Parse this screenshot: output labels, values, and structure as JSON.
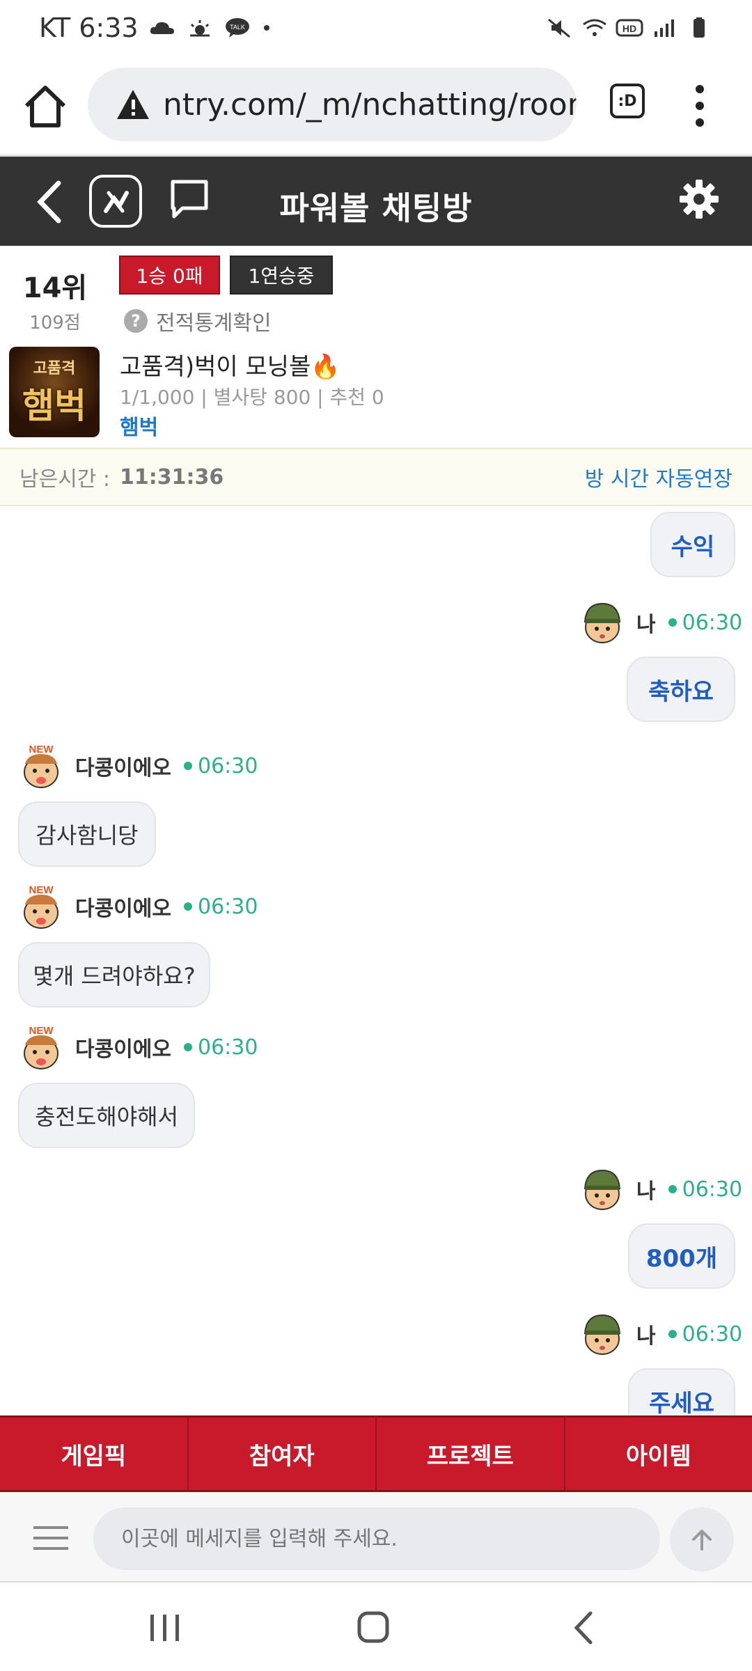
{
  "status_bar": {
    "carrier_time": "KT 6:33",
    "icons": [
      "cloud-icon",
      "sunrise-icon",
      "talk-icon",
      "dot-icon",
      "mute-icon",
      "wifi-icon",
      "hd-icon",
      "signal-icon",
      "battery-icon"
    ],
    "talk_badge": "TALK",
    "hd_badge": "HD"
  },
  "browser": {
    "url": "ntry.com/_m/nchatting/room",
    "tab_switcher_label": ":D"
  },
  "header": {
    "title": "파워볼 채팅방"
  },
  "room": {
    "rank": "14위",
    "points": "109점",
    "record_badge": "1승 0패",
    "streak_badge": "1연승중",
    "stats_link": "전적통계확인",
    "thumb_top": "고품격",
    "thumb_main": "햄벅",
    "name": "고품격)벅이 모닝볼🔥",
    "meta": "1/1,000 | 별사탕 800 | 추천 0",
    "owner": "햄벅"
  },
  "timer": {
    "label": "남은시간 :",
    "value": "11:31:36",
    "extend_link": "방 시간 자동연장"
  },
  "messages": [
    {
      "sender": "",
      "time": "",
      "text": "수익",
      "mine": true
    },
    {
      "sender": "나",
      "time": "06:30",
      "text": "축하요",
      "mine": true
    },
    {
      "sender": "다콩이에오",
      "time": "06:30",
      "text": "감사함니당",
      "mine": false
    },
    {
      "sender": "다콩이에오",
      "time": "06:30",
      "text": "몇개 드려야하요?",
      "mine": false
    },
    {
      "sender": "다콩이에오",
      "time": "06:30",
      "text": "충전도해야해서",
      "mine": false
    },
    {
      "sender": "나",
      "time": "06:30",
      "text": "800개",
      "mine": true
    },
    {
      "sender": "나",
      "time": "06:30",
      "text": "주세요",
      "mine": true
    }
  ],
  "new_badge": "NEW",
  "tabs": [
    "게임픽",
    "참여자",
    "프로젝트",
    "아이템"
  ],
  "input": {
    "placeholder": "이곳에 메세지를 입력해 주세요."
  },
  "colors": {
    "accent_red": "#c81a2a",
    "header_dark": "#333333",
    "link_blue": "#1e79c8",
    "time_green": "#2bb08a"
  }
}
